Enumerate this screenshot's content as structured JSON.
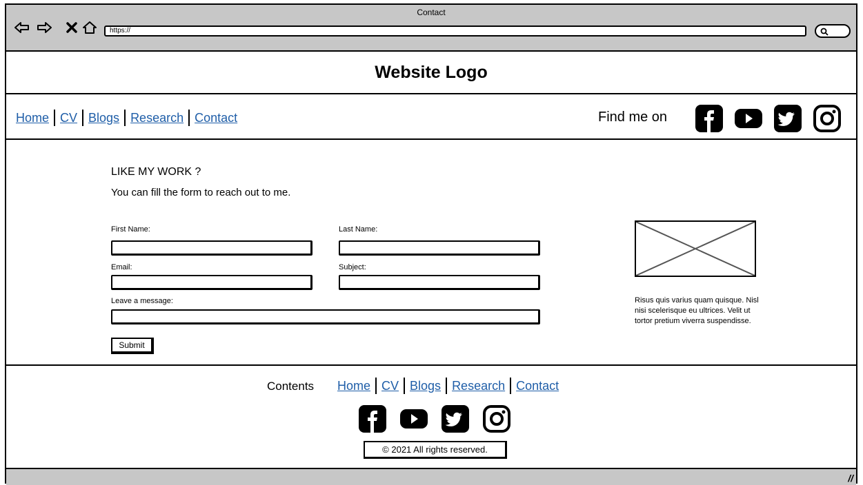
{
  "window": {
    "title": "Contact"
  },
  "toolbar": {
    "url": "https://"
  },
  "header": {
    "logo": "Website Logo"
  },
  "nav": {
    "links": [
      "Home",
      "CV",
      "Blogs",
      "Research",
      "Contact"
    ],
    "find_me": "Find me on",
    "social": [
      "facebook-icon",
      "youtube-icon",
      "twitter-icon",
      "instagram-icon"
    ]
  },
  "content": {
    "heading": "LIKE MY WORK ?",
    "subheading": "You can fill the form to reach out to me.",
    "form": {
      "first_name_label": "First Name:",
      "last_name_label": "Last Name:",
      "email_label": "Email:",
      "subject_label": "Subject:",
      "message_label": "Leave a message:",
      "first_name_value": "",
      "last_name_value": "",
      "email_value": "",
      "subject_value": "",
      "message_value": "",
      "submit_label": "Submit"
    },
    "sidebar_text": "Risus quis varius quam quisque. Nisl nisi scelerisque eu ultrices. Velit ut tortor pretium viverra suspendisse."
  },
  "footer": {
    "contents_label": "Contents",
    "links": [
      "Home",
      "CV",
      "Blogs",
      "Research",
      "Contact"
    ],
    "copyright": "© 2021 All rights reserved."
  },
  "colors": {
    "chrome": "#c7c7c7",
    "link": "#1f5ea8",
    "border": "#000000"
  }
}
